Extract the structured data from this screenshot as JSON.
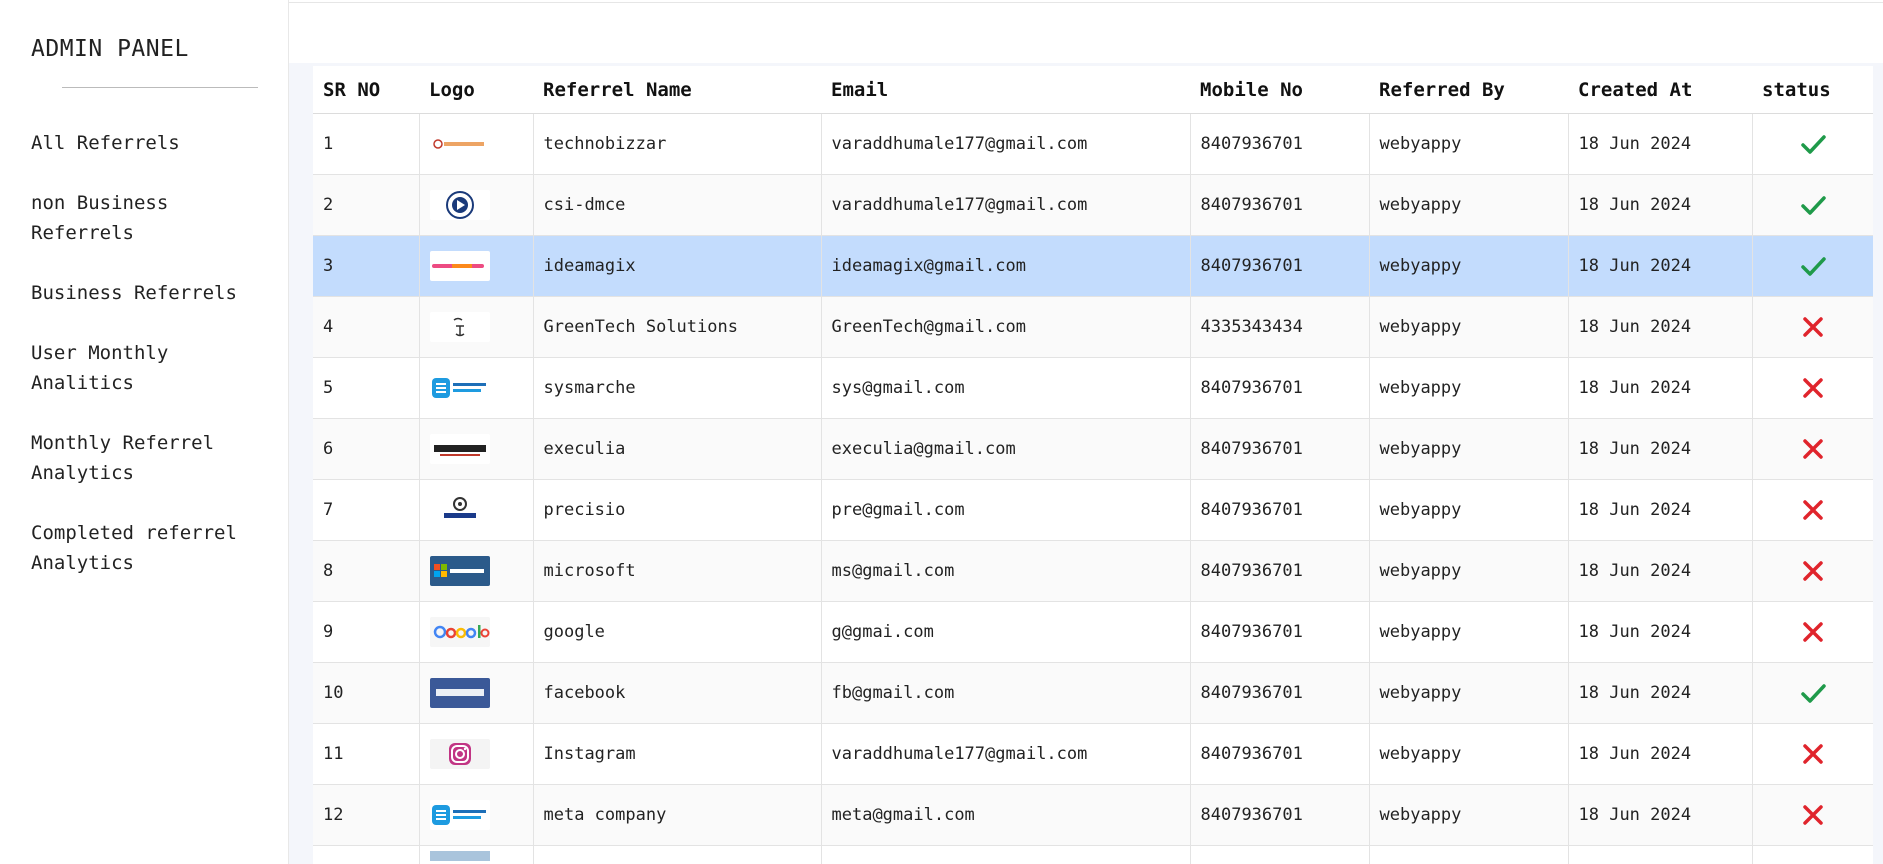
{
  "sidebar": {
    "title": "ADMIN PANEL",
    "items": [
      {
        "label": "All Referrels"
      },
      {
        "label": "non Business Referrels"
      },
      {
        "label": "Business Referrels"
      },
      {
        "label": "User Monthly Analitics"
      },
      {
        "label": "Monthly Referrel Analytics"
      },
      {
        "label": "Completed referrel Analytics"
      }
    ]
  },
  "table": {
    "headers": [
      "SR NO",
      "Logo",
      "Referrel Name",
      "Email",
      "Mobile No",
      "Referred By",
      "Created At",
      "status"
    ],
    "selected_row": 3,
    "rows": [
      {
        "sr": "1",
        "logo": "technobizzar-logo",
        "name": "technobizzar",
        "email": "varaddhumale177@gmail.com",
        "mobile": "8407936701",
        "referred_by": "webyappy",
        "created_at": "18 Jun 2024",
        "status": "check"
      },
      {
        "sr": "2",
        "logo": "csi-dmce-logo",
        "name": "csi-dmce",
        "email": "varaddhumale177@gmail.com",
        "mobile": "8407936701",
        "referred_by": "webyappy",
        "created_at": "18 Jun 2024",
        "status": "check"
      },
      {
        "sr": "3",
        "logo": "ideamagix-logo",
        "name": "ideamagix",
        "email": "ideamagix@gmail.com",
        "mobile": "8407936701",
        "referred_by": "webyappy",
        "created_at": "18 Jun 2024",
        "status": "check"
      },
      {
        "sr": "4",
        "logo": "greentech-logo",
        "name": "GreenTech Solutions",
        "email": "GreenTech@gmail.com",
        "mobile": "4335343434",
        "referred_by": "webyappy",
        "created_at": "18 Jun 2024",
        "status": "cross"
      },
      {
        "sr": "5",
        "logo": "sysmarche-logo",
        "name": "sysmarche",
        "email": "sys@gmail.com",
        "mobile": "8407936701",
        "referred_by": "webyappy",
        "created_at": "18 Jun 2024",
        "status": "cross"
      },
      {
        "sr": "6",
        "logo": "execulia-logo",
        "name": "execulia",
        "email": "execulia@gmail.com",
        "mobile": "8407936701",
        "referred_by": "webyappy",
        "created_at": "18 Jun 2024",
        "status": "cross"
      },
      {
        "sr": "7",
        "logo": "precisio-logo",
        "name": "precisio",
        "email": "pre@gmail.com",
        "mobile": "8407936701",
        "referred_by": "webyappy",
        "created_at": "18 Jun 2024",
        "status": "cross"
      },
      {
        "sr": "8",
        "logo": "microsoft-logo",
        "name": "microsoft",
        "email": "ms@gmail.com",
        "mobile": "8407936701",
        "referred_by": "webyappy",
        "created_at": "18 Jun 2024",
        "status": "cross"
      },
      {
        "sr": "9",
        "logo": "google-logo",
        "name": "google",
        "email": "g@gmai.com",
        "mobile": "8407936701",
        "referred_by": "webyappy",
        "created_at": "18 Jun 2024",
        "status": "cross"
      },
      {
        "sr": "10",
        "logo": "facebook-logo",
        "name": "facebook",
        "email": "fb@gmail.com",
        "mobile": "8407936701",
        "referred_by": "webyappy",
        "created_at": "18 Jun 2024",
        "status": "check"
      },
      {
        "sr": "11",
        "logo": "instagram-logo",
        "name": "Instagram",
        "email": "varaddhumale177@gmail.com",
        "mobile": "8407936701",
        "referred_by": "webyappy",
        "created_at": "18 Jun 2024",
        "status": "cross"
      },
      {
        "sr": "12",
        "logo": "sysmarche-logo",
        "name": "meta company",
        "email": "meta@gmail.com",
        "mobile": "8407936701",
        "referred_by": "webyappy",
        "created_at": "18 Jun 2024",
        "status": "cross"
      }
    ]
  },
  "colors": {
    "check": "#1f9a4a",
    "cross": "#e0242c",
    "selected_row_bg": "#c3dcfd",
    "content_bg": "#f4f6fb"
  }
}
